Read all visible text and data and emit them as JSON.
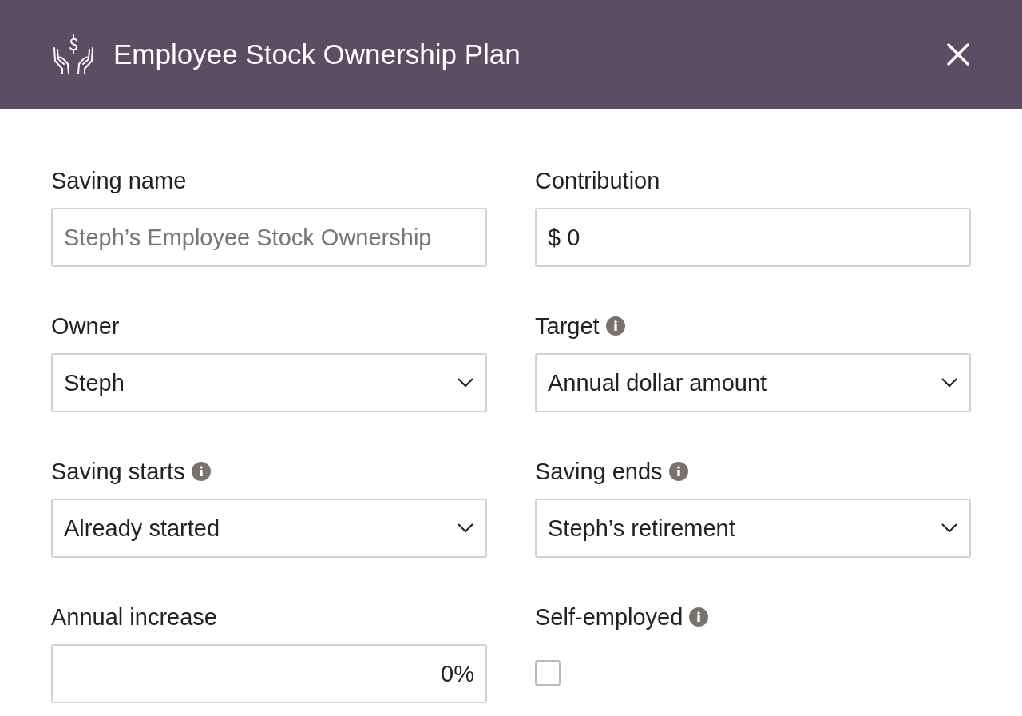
{
  "header": {
    "title": "Employee Stock Ownership Plan"
  },
  "fields": [
    {
      "kind": "text",
      "label": "Saving name",
      "info": false,
      "placeholder": "Steph’s Employee Stock Ownership"
    },
    {
      "kind": "currency",
      "label": "Contribution",
      "info": false,
      "prefix": "$",
      "value": "0"
    },
    {
      "kind": "select",
      "label": "Owner",
      "info": false,
      "value": "Steph"
    },
    {
      "kind": "select",
      "label": "Target",
      "info": true,
      "value": "Annual dollar amount"
    },
    {
      "kind": "select",
      "label": "Saving starts",
      "info": true,
      "value": "Already started"
    },
    {
      "kind": "select",
      "label": "Saving ends",
      "info": true,
      "value": "Steph’s retirement"
    },
    {
      "kind": "percent",
      "label": "Annual increase",
      "info": false,
      "value": "0%"
    },
    {
      "kind": "checkbox",
      "label": "Self-employed",
      "info": true,
      "checked": false
    }
  ]
}
